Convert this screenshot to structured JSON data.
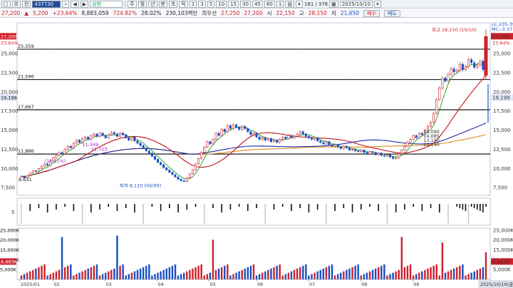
{
  "toolbar": {
    "items": [
      "□",
      "☰",
      "전",
      "▾"
    ],
    "code": "437730",
    "nav": [
      "◀",
      "▶"
    ],
    "name": "삼현",
    "periods": [
      "주",
      "월",
      "년",
      "분",
      "초",
      "틱"
    ],
    "intervals": [
      "1",
      "3",
      "5",
      "10",
      "15",
      "30",
      "45",
      "60"
    ],
    "count": "181",
    "total": "376",
    "date": "2025/10/10"
  },
  "quote": {
    "price": "27,200",
    "change": "5,200",
    "change_pct": "+23.64%",
    "volume": "8,883,059",
    "vol_ratio": "724.82%",
    "turnover": "28.02%",
    "amount": "230,103백만",
    "pref_label": "희우선",
    "pref_value": "27,250",
    "pref_value2": "27,200",
    "open_label": "시",
    "open": "22,150",
    "high_label": "고",
    "high": "28,150",
    "low_label": "저",
    "low": "21,650",
    "buy": "매수",
    "sell": "매도"
  },
  "colors": {
    "up": "#d0202a",
    "down": "#1a4fc4",
    "ma5": "#1a9a1a",
    "ma20": "#c0101a",
    "ma60": "#1a2aa0",
    "ma120": "#e08a20"
  },
  "chart_data": {
    "type": "line",
    "price_ylim": [
      6500,
      29000
    ],
    "price_ticks": [
      7500,
      10000,
      12500,
      15000,
      17500,
      20000,
      22500,
      25000
    ],
    "right_tag_price": "27,200",
    "right_tag_pct": "23.64%",
    "right_tag_low": "19,199",
    "right_header": [
      "LC:235.39",
      "MC:-3.37"
    ],
    "left_tag_price": "27,200",
    "left_tag_pct": "23.64%",
    "left_tag_low": "19,199",
    "hlines": [
      {
        "value": 25559,
        "label": "25,559"
      },
      {
        "value": 21596,
        "label": "21,596"
      },
      {
        "value": 17667,
        "label": "17,667"
      },
      {
        "value": 11886,
        "label": "11,886"
      }
    ],
    "annotations": {
      "high": "최고 28,150 (10/10)",
      "low": "최저 8,110 (04/09)",
      "start": "8,631",
      "mid1": "11,349",
      "mid2": "(15.11%)",
      "mid3": "11,723",
      "box_right": [
        "14,090",
        "14,085",
        "13,190",
        "13,190"
      ]
    },
    "months": [
      "2025/01",
      "02",
      "03",
      "04",
      "05",
      "06",
      "07",
      "08",
      "09",
      "2025/10/10(금)"
    ],
    "closes": [
      9000,
      8800,
      9100,
      9400,
      9700,
      9600,
      10000,
      10300,
      10600,
      10400,
      11000,
      11400,
      11700,
      12100,
      11900,
      12500,
      12900,
      12700,
      13300,
      13700,
      13400,
      13900,
      14100,
      13800,
      14300,
      14500,
      14200,
      14600,
      14300,
      14000,
      14400,
      14700,
      14500,
      14200,
      14600,
      14400,
      14000,
      13700,
      14100,
      13600,
      13300,
      13000,
      12700,
      12300,
      12000,
      11600,
      11200,
      10800,
      10500,
      10100,
      9800,
      9500,
      9200,
      8900,
      8600,
      8400,
      8300,
      8800,
      9300,
      9800,
      10600,
      11300,
      12100,
      12800,
      13500,
      13200,
      13800,
      14600,
      14300,
      15100,
      14800,
      15600,
      15200,
      15700,
      15400,
      15100,
      15500,
      15200,
      14800,
      14400,
      14600,
      14100,
      13800,
      14000,
      13700,
      13900,
      13500,
      13700,
      13400,
      13800,
      14100,
      13900,
      14300,
      14000,
      14200,
      14500,
      14800,
      14500,
      14200,
      14000,
      13800,
      14000,
      13600,
      13400,
      13200,
      13500,
      13100,
      12900,
      13100,
      12800,
      12600,
      12900,
      12700,
      12400,
      12500,
      12300,
      12200,
      12400,
      12100,
      11900,
      12200,
      12100,
      11800,
      12000,
      11700,
      11600,
      11800,
      11500,
      11300,
      11400,
      11900,
      12400,
      12900,
      13400,
      13800,
      14300,
      14000,
      14600,
      14400,
      15000,
      15500,
      16000,
      17200,
      19000,
      20500,
      21800,
      21400,
      22300,
      23000,
      22600,
      22800,
      23600,
      22900,
      23300,
      24200,
      23800,
      23200,
      23500,
      24000,
      22900,
      27200
    ],
    "volume_ylim": [
      0,
      26000
    ],
    "volume_ticks": [
      "5,000K",
      "10,000K",
      "15,000K",
      "20,000K",
      "25,000K"
    ],
    "volume_tag": "8,883K",
    "volume_tag2": "8,883K",
    "mid_panel_label": "5"
  }
}
